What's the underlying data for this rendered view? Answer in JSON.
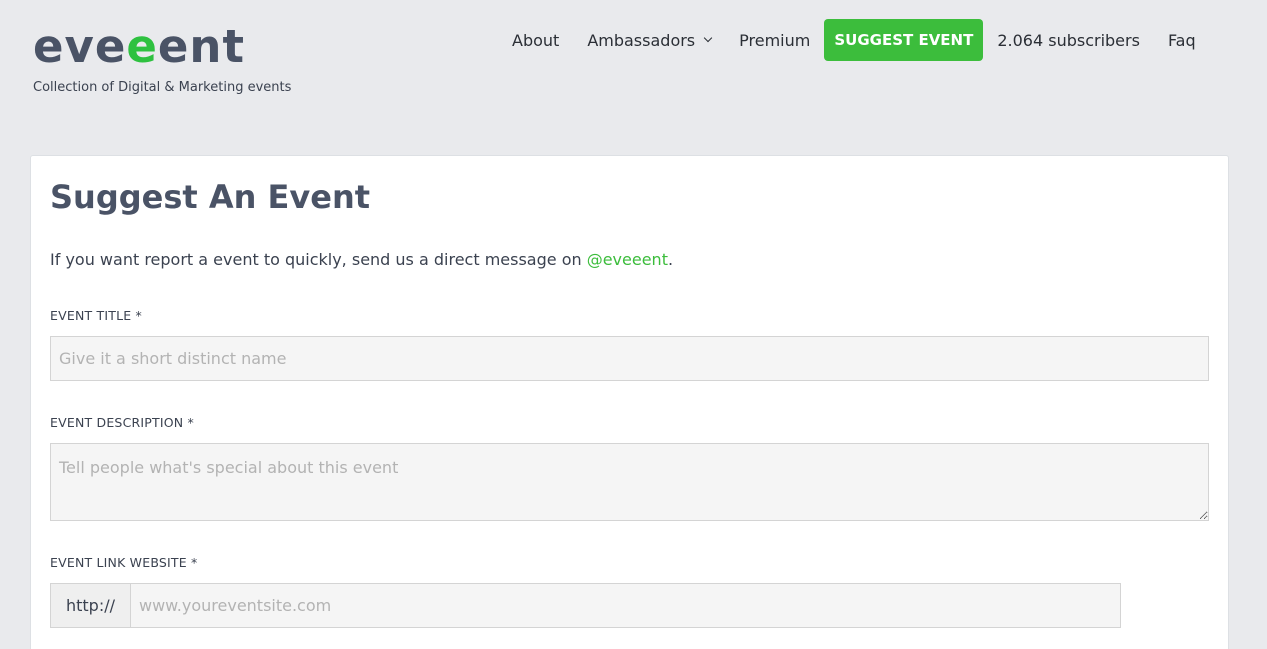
{
  "header": {
    "logo": {
      "part1": "eve",
      "part2": "e",
      "part3": "ent"
    },
    "tagline": "Collection of Digital & Marketing events",
    "nav": {
      "about": "About",
      "ambassadors": "Ambassadors",
      "premium": "Premium",
      "suggest": "SUGGEST EVENT",
      "subscribers": "2.064 subscribers",
      "faq": "Faq"
    }
  },
  "colors": {
    "brand_green": "#3cbd3c",
    "logo_text": "#4a5366"
  },
  "form": {
    "title": "Suggest An Event",
    "intro_text": "If you want report a event to quickly, send us a direct message on ",
    "intro_link": "@eveeent",
    "intro_end": ".",
    "event_title_label": "EVENT TITLE *",
    "event_title_placeholder": "Give it a short distinct name",
    "event_description_label": "EVENT DESCRIPTION *",
    "event_description_placeholder": "Tell people what's special about this event",
    "event_link_label": "EVENT LINK WEBSITE *",
    "event_link_prefix": "http://",
    "event_link_placeholder": "www.youreventsite.com"
  }
}
